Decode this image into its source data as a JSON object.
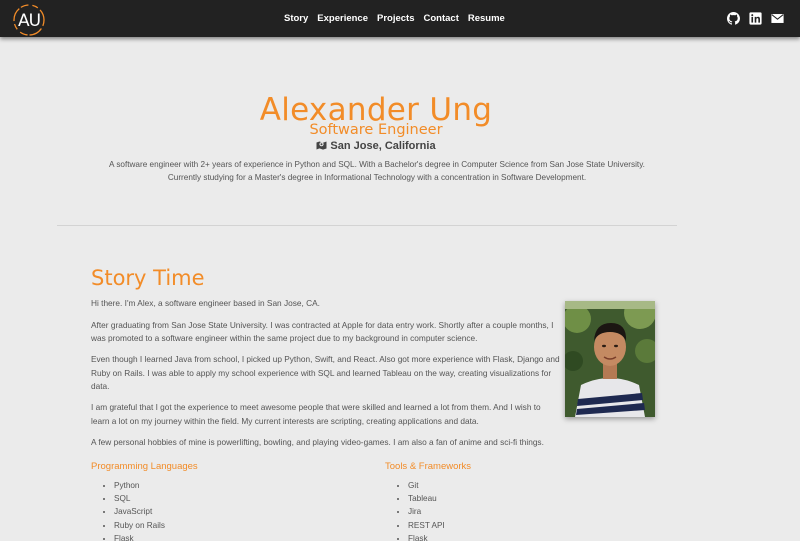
{
  "nav": {
    "logo_text": "AU",
    "links": [
      "Story",
      "Experience",
      "Projects",
      "Contact",
      "Resume"
    ],
    "icons": [
      "github-icon",
      "linkedin-icon",
      "mail-icon"
    ]
  },
  "hero": {
    "name": "Alexander Ung",
    "role": "Software Engineer",
    "location": "San Jose, California",
    "description": "A software engineer with 2+ years of experience in Python and SQL. With a Bachelor's degree in Computer Science from San Jose State University. Currently studying for a Master's degree in Informational Technology with a concentration in Software Development."
  },
  "story": {
    "title": "Story Time",
    "paragraphs": [
      "Hi there. I'm Alex, a software engineer based in San Jose, CA.",
      "After graduating from San Jose State University. I was contracted at Apple for data entry work. Shortly after a couple months, I was promoted to a software engineer within the same project due to my background in computer science.",
      "Even though I learned Java from school, I picked up Python, Swift, and React. Also got more experience with Flask, Django and Ruby on Rails. I was able to apply my school experience with SQL and learned Tableau on the way, creating visualizations for data.",
      "I am grateful that I got the experience to meet awesome people that were skilled and learned a lot from them. And I wish to learn a lot on my journey within the field. My current interests are scripting, creating applications and data.",
      "A few personal hobbies of mine is powerlifting, bowling, and playing video-games. I am also a fan of anime and sci-fi things."
    ]
  },
  "skills": {
    "languages": {
      "title": "Programming Languages",
      "items": [
        "Python",
        "SQL",
        "JavaScript",
        "Ruby on Rails",
        "Flask"
      ]
    },
    "tools": {
      "title": "Tools & Frameworks",
      "items": [
        "Git",
        "Tableau",
        "Jira",
        "REST API",
        "Flask"
      ]
    }
  },
  "colors": {
    "accent": "#f28c28",
    "navbar": "#222222",
    "background": "#ebebeb"
  }
}
